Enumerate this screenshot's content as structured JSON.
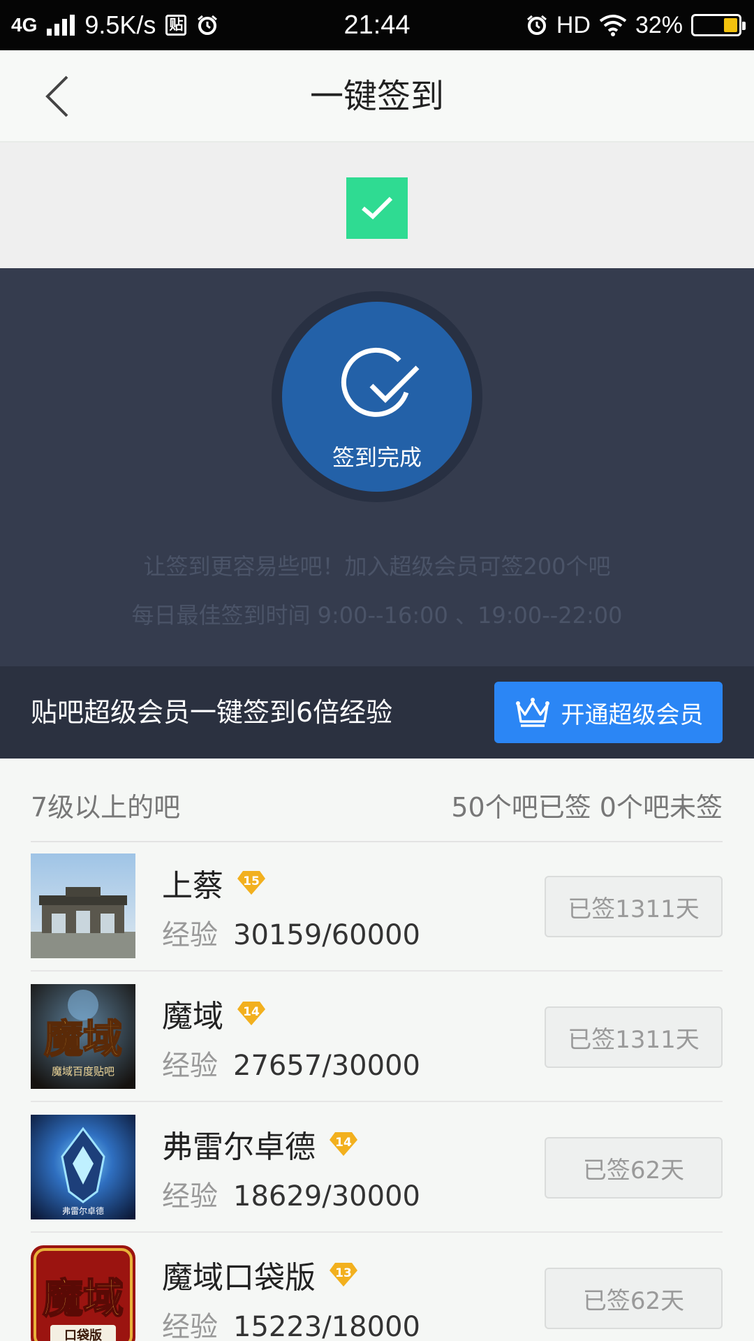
{
  "status_bar": {
    "network": "4G",
    "speed": "9.5K/s",
    "tieba_badge": "贴",
    "time": "21:44",
    "hd": "HD",
    "battery_pct": "32%",
    "battery_level": 0.32
  },
  "nav": {
    "title": "一键签到"
  },
  "sign_circle": {
    "label": "签到完成"
  },
  "tips": {
    "line1": "让签到更容易些吧！加入超级会员可签200个吧",
    "line2": "每日最佳签到时间  9:00--16:00 、19:00--22:00"
  },
  "vip": {
    "text": "贴吧超级会员一键签到6倍经验",
    "button": "开通超级会员"
  },
  "list_header": {
    "left": "7级以上的吧",
    "right": "50个吧已签 0个吧未签"
  },
  "forums": [
    {
      "name": "上蔡",
      "level": "15",
      "exp_label": "经验",
      "exp": "30159/60000",
      "status": "已签1311天",
      "thumb": "gate"
    },
    {
      "name": "魔域",
      "level": "14",
      "exp_label": "经验",
      "exp": "27657/30000",
      "status": "已签1311天",
      "thumb": "moyu",
      "thumb_title": "魔域",
      "thumb_sub": "魔域百度贴吧"
    },
    {
      "name": "弗雷尔卓德",
      "level": "14",
      "exp_label": "经验",
      "exp": "18629/30000",
      "status": "已签62天",
      "thumb": "freljord",
      "thumb_sub": "弗雷尔卓德"
    },
    {
      "name": "魔域口袋版",
      "level": "13",
      "exp_label": "经验",
      "exp": "15223/18000",
      "status": "已签62天",
      "thumb": "moyu-pocket",
      "thumb_title": "魔域",
      "thumb_sub": "口袋版"
    }
  ],
  "colors": {
    "accent_blue": "#2b86f5",
    "success_green": "#2fdb92",
    "dark_panel": "#353c4e",
    "circle_blue": "#2361a8",
    "level_gold": "#f2b01e"
  }
}
